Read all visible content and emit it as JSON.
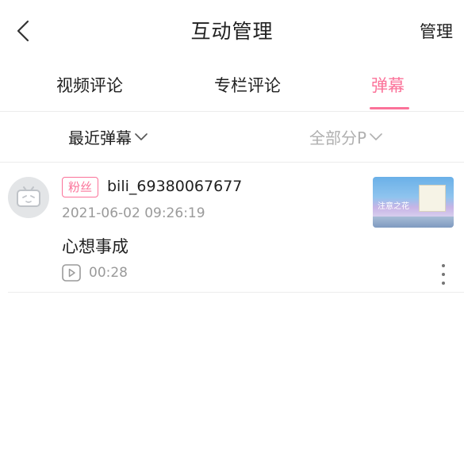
{
  "header": {
    "title": "互动管理",
    "manage_label": "管理"
  },
  "tabs": [
    {
      "label": "视频评论",
      "active": false
    },
    {
      "label": "专栏评论",
      "active": false
    },
    {
      "label": "弹幕",
      "active": true
    }
  ],
  "filters": {
    "sort_label": "最近弹幕",
    "part_label": "全部分P"
  },
  "items": [
    {
      "badge": "粉丝",
      "username": "bili_69380067677",
      "timestamp": "2021-06-02 09:26:19",
      "content": "心想事成",
      "video_time": "00:28",
      "thumbnail_text": "注意之花"
    }
  ],
  "colors": {
    "accent": "#fb7299",
    "text": "#212121",
    "muted": "#9a9a9a"
  }
}
